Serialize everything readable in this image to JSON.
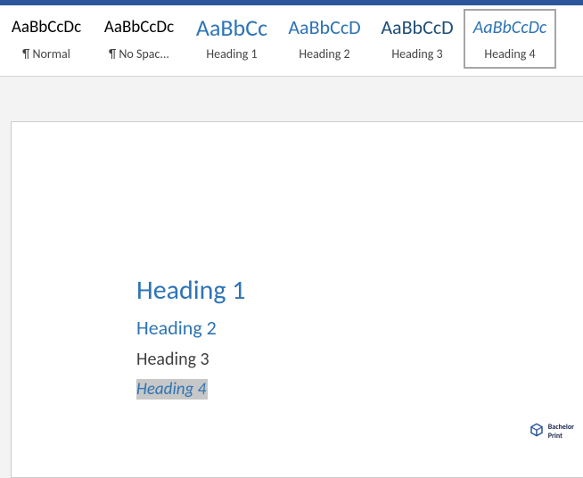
{
  "ribbon": {
    "styles": [
      {
        "id": "normal",
        "preview": "AaBbCcDc",
        "label": "¶ Normal"
      },
      {
        "id": "nospace",
        "preview": "AaBbCcDc",
        "label": "¶ No Spac..."
      },
      {
        "id": "h1",
        "preview": "AaBbCc",
        "label": "Heading 1"
      },
      {
        "id": "h2",
        "preview": "AaBbCcD",
        "label": "Heading 2"
      },
      {
        "id": "h3",
        "preview": "AaBbCcD",
        "label": "Heading 3"
      },
      {
        "id": "h4",
        "preview": "AaBbCcDc",
        "label": "Heading 4"
      }
    ]
  },
  "document": {
    "h1": "Heading 1",
    "h2": "Heading 2",
    "h3": "Heading 3",
    "h4": "Heading 4"
  },
  "watermark": {
    "line1": "Bachelor",
    "line2": "Print"
  }
}
